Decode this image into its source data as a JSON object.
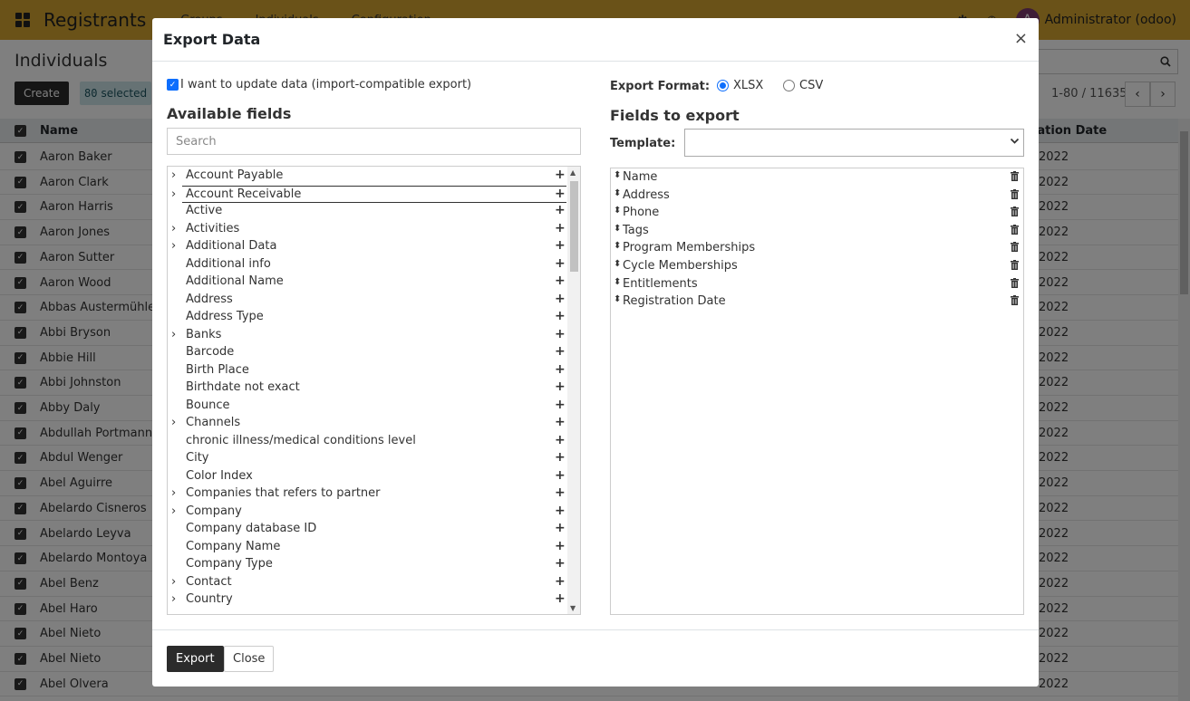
{
  "navbar": {
    "brand": "Registrants",
    "menu": [
      "Groups",
      "Individuals",
      "Configuration"
    ],
    "user_initial": "A",
    "user_name": "Administrator (odoo)"
  },
  "control_panel": {
    "title": "Individuals",
    "create_label": "Create",
    "selected_count": "80",
    "selected_label": "selected",
    "pager": "1-80 / 11635"
  },
  "list": {
    "col_name": "Name",
    "col_reg_date": "ration Date",
    "rows": [
      {
        "name": "Aaron Baker",
        "date": "2022"
      },
      {
        "name": "Aaron Clark",
        "date": "2022"
      },
      {
        "name": "Aaron Harris",
        "date": "2022"
      },
      {
        "name": "Aaron Jones",
        "date": "2022"
      },
      {
        "name": "Aaron Sutter",
        "date": "2022"
      },
      {
        "name": "Aaron Wood",
        "date": "2022"
      },
      {
        "name": "Abbas Austermühle",
        "date": "2022"
      },
      {
        "name": "Abbi Bryson",
        "date": "2022"
      },
      {
        "name": "Abbie Hill",
        "date": "2022"
      },
      {
        "name": "Abbi Johnston",
        "date": "2022"
      },
      {
        "name": "Abby Daly",
        "date": "2022"
      },
      {
        "name": "Abdullah Portmann",
        "date": "2022"
      },
      {
        "name": "Abdul Wenger",
        "date": "2022"
      },
      {
        "name": "Abel Aguirre",
        "date": "2022"
      },
      {
        "name": "Abelardo Cisneros",
        "date": "2022"
      },
      {
        "name": "Abelardo Leyva",
        "date": "2022"
      },
      {
        "name": "Abelardo Montoya",
        "date": "2022"
      },
      {
        "name": "Abel Benz",
        "date": "2022"
      },
      {
        "name": "Abel Haro",
        "date": "2022"
      },
      {
        "name": "Abel Nieto",
        "date": "2022"
      },
      {
        "name": "Abel Nieto",
        "date": "2022"
      },
      {
        "name": "Abel Olvera",
        "date": "2022"
      }
    ]
  },
  "modal": {
    "title": "Export Data",
    "close_glyph": "×",
    "import_compat_label": "I want to update data (import-compatible export)",
    "import_compat_checked": true,
    "available_title": "Available fields",
    "search_placeholder": "Search",
    "available_fields": [
      {
        "label": "Account Payable",
        "expandable": true
      },
      {
        "label": "Account Receivable",
        "expandable": true,
        "focused": true
      },
      {
        "label": "Active",
        "expandable": false
      },
      {
        "label": "Activities",
        "expandable": true
      },
      {
        "label": "Additional Data",
        "expandable": true
      },
      {
        "label": "Additional info",
        "expandable": false
      },
      {
        "label": "Additional Name",
        "expandable": false
      },
      {
        "label": "Address",
        "expandable": false
      },
      {
        "label": "Address Type",
        "expandable": false
      },
      {
        "label": "Banks",
        "expandable": true
      },
      {
        "label": "Barcode",
        "expandable": false
      },
      {
        "label": "Birth Place",
        "expandable": false
      },
      {
        "label": "Birthdate not exact",
        "expandable": false
      },
      {
        "label": "Bounce",
        "expandable": false
      },
      {
        "label": "Channels",
        "expandable": true
      },
      {
        "label": "chronic illness/medical conditions level",
        "expandable": false
      },
      {
        "label": "City",
        "expandable": false
      },
      {
        "label": "Color Index",
        "expandable": false
      },
      {
        "label": "Companies that refers to partner",
        "expandable": true
      },
      {
        "label": "Company",
        "expandable": true
      },
      {
        "label": "Company database ID",
        "expandable": false
      },
      {
        "label": "Company Name",
        "expandable": false
      },
      {
        "label": "Company Type",
        "expandable": false
      },
      {
        "label": "Contact",
        "expandable": true
      },
      {
        "label": "Country",
        "expandable": true
      }
    ],
    "format_label": "Export Format:",
    "formats": [
      {
        "label": "XLSX",
        "selected": true
      },
      {
        "label": "CSV",
        "selected": false
      }
    ],
    "fields_to_export_title": "Fields to export",
    "template_label": "Template:",
    "template_value": "",
    "export_fields": [
      "Name",
      "Address",
      "Phone",
      "Tags",
      "Program Memberships",
      "Cycle Memberships",
      "Entitlements",
      "Registration Date"
    ],
    "export_button": "Export",
    "close_button": "Close"
  },
  "colors": {
    "navbar": "#d4a531",
    "primary_dark": "#2b2b2b",
    "checkbox_blue": "#0d6efd",
    "badge_bg": "#cce4e8"
  }
}
